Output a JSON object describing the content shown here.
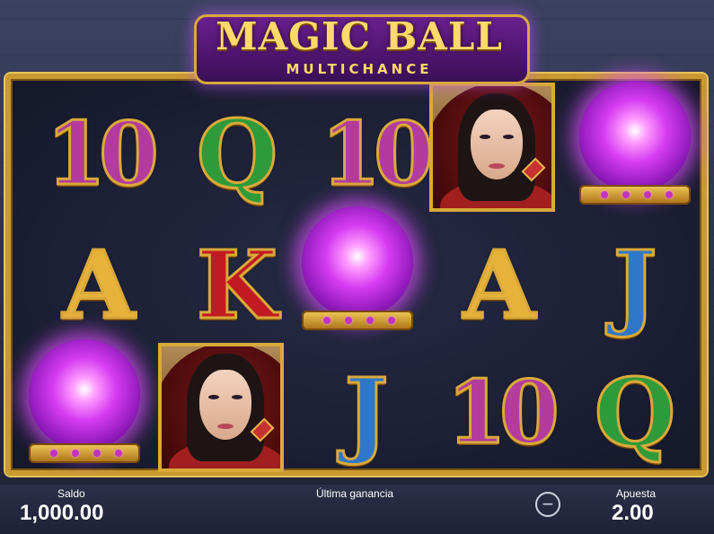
{
  "game": {
    "title": "MAGIC BALL",
    "subtitle": "MULTICHANCE"
  },
  "reels": [
    [
      "10",
      "A",
      "orb"
    ],
    [
      "Q",
      "K",
      "portrait"
    ],
    [
      "10",
      "orb",
      "J"
    ],
    [
      "portrait",
      "A",
      "10"
    ],
    [
      "orb",
      "J",
      "Q"
    ]
  ],
  "symbols": {
    "ten_label": "10",
    "q_label": "Q",
    "k_label": "K",
    "a_label": "A",
    "j_label": "J"
  },
  "symbol_colors": {
    "10": "#b33b9e",
    "Q": "#2f9a3a",
    "K": "#c11a22",
    "A": "#e7b23a",
    "J": "#2f78c9"
  },
  "footer": {
    "balance_label": "Saldo",
    "balance_value": "1,000.00",
    "last_win_label": "Última ganancia",
    "last_win_value": "",
    "bet_label": "Apuesta",
    "bet_value": "2.00",
    "decrease_bet_symbol": "−"
  }
}
